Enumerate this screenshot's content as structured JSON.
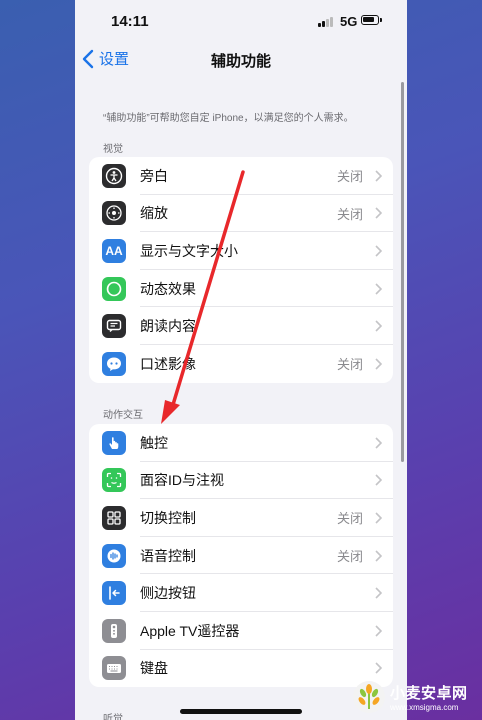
{
  "status_bar": {
    "time": "14:11",
    "network": "5G"
  },
  "nav": {
    "back_label": "设置",
    "title": "辅助功能"
  },
  "description": "“辅助功能”可帮助您自定 iPhone，以满足您的个人需求。",
  "sections": [
    {
      "header": "视觉",
      "items": [
        {
          "label": "旁白",
          "value": "关闭",
          "icon": "voiceover-icon",
          "color": "#2c2c2e"
        },
        {
          "label": "缩放",
          "value": "关闭",
          "icon": "zoom-icon",
          "color": "#2c2c2e"
        },
        {
          "label": "显示与文字大小",
          "value": "",
          "icon": "display-text-size-icon",
          "color": "#2f7fe0"
        },
        {
          "label": "动态效果",
          "value": "",
          "icon": "motion-icon",
          "color": "#34c759"
        },
        {
          "label": "朗读内容",
          "value": "",
          "icon": "spoken-content-icon",
          "color": "#2c2c2e"
        },
        {
          "label": "口述影像",
          "value": "关闭",
          "icon": "audio-descriptions-icon",
          "color": "#2f7fe0"
        }
      ]
    },
    {
      "header": "动作交互",
      "items": [
        {
          "label": "触控",
          "value": "",
          "icon": "touch-icon",
          "color": "#2f7fe0"
        },
        {
          "label": "面容ID与注视",
          "value": "",
          "icon": "face-id-icon",
          "color": "#34c759"
        },
        {
          "label": "切换控制",
          "value": "关闭",
          "icon": "switch-control-icon",
          "color": "#2c2c2e"
        },
        {
          "label": "语音控制",
          "value": "关闭",
          "icon": "voice-control-icon",
          "color": "#2f7fe0"
        },
        {
          "label": "侧边按钮",
          "value": "",
          "icon": "side-button-icon",
          "color": "#2f7fe0"
        },
        {
          "label": "Apple TV遥控器",
          "value": "",
          "icon": "apple-tv-remote-icon",
          "color": "#8e8e93"
        },
        {
          "label": "键盘",
          "value": "",
          "icon": "keyboard-icon",
          "color": "#8e8e93"
        }
      ]
    },
    {
      "header": "听觉",
      "items": []
    }
  ],
  "watermark": {
    "name": "小麦安卓网",
    "url": "www.xmsigma.com"
  },
  "colors": {
    "accent": "#1a73e8",
    "arrow": "#e8282b"
  }
}
